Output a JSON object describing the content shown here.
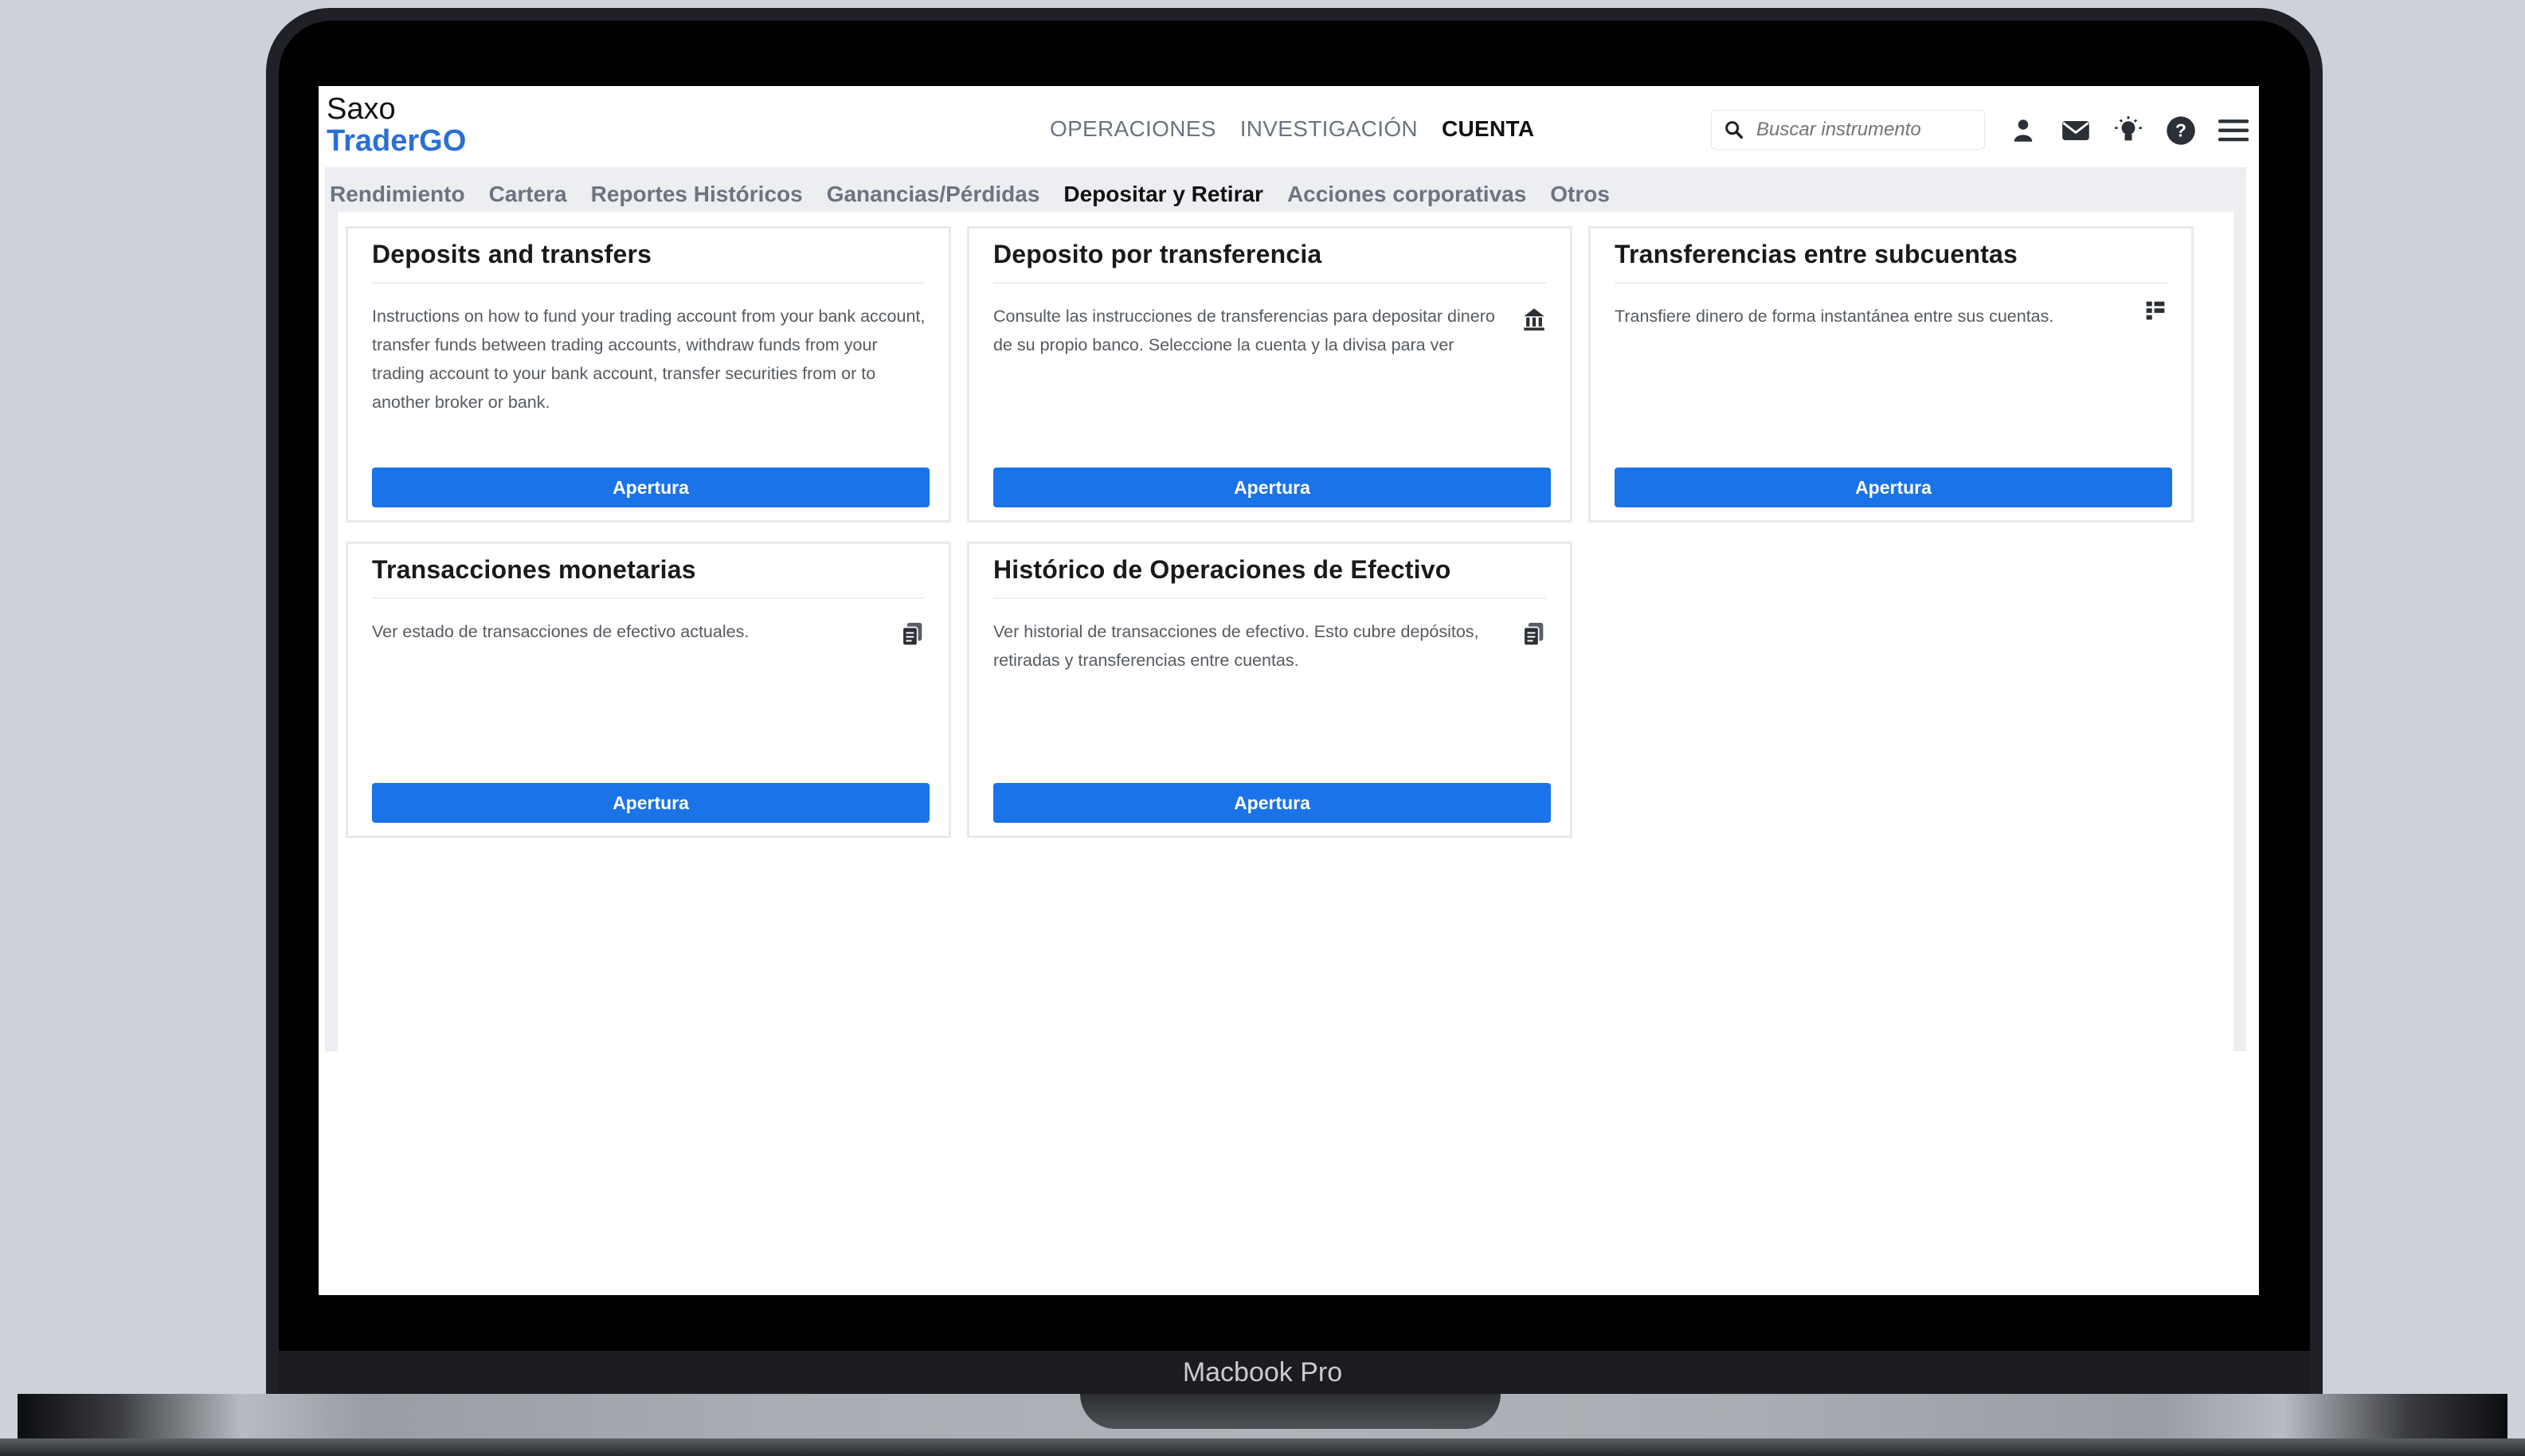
{
  "device": {
    "label": "Macbook Pro"
  },
  "logo": {
    "line1": "Saxo",
    "line2": "TraderGO"
  },
  "topnav": [
    {
      "label": "OPERACIONES",
      "active": false
    },
    {
      "label": "INVESTIGACIÓN",
      "active": false
    },
    {
      "label": "CUENTA",
      "active": true
    }
  ],
  "search": {
    "placeholder": "Buscar instrumento"
  },
  "header_icons": [
    "user-icon",
    "mail-icon",
    "lightbulb-icon",
    "help-icon",
    "menu-icon"
  ],
  "subnav": [
    {
      "label": "Rendimiento",
      "active": false
    },
    {
      "label": "Cartera",
      "active": false
    },
    {
      "label": "Reportes Históricos",
      "active": false
    },
    {
      "label": "Ganancias/Pérdidas",
      "active": false
    },
    {
      "label": "Depositar y Retirar",
      "active": true
    },
    {
      "label": "Acciones corporativas",
      "active": false
    },
    {
      "label": "Otros",
      "active": false
    }
  ],
  "cards": [
    {
      "title": "Deposits and transfers",
      "description": "Instructions on how to fund your trading account from your bank account, transfer funds between trading accounts, withdraw funds from your trading account to your bank account, transfer securities from or to another broker or bank.",
      "button": "Apertura"
    },
    {
      "title": "Deposito por transferencia",
      "description": "Consulte las instrucciones de transferencias para depositar dinero de su propio banco. Seleccione la cuenta y la divisa para ver",
      "icon": "bank-icon",
      "button": "Apertura"
    },
    {
      "title": "Transferencias entre subcuentas",
      "description": "Transfiere dinero de forma instantánea entre sus cuentas.",
      "icon": "transfer-icon",
      "button": "Apertura"
    },
    {
      "title": "Transacciones monetarias",
      "description": "Ver estado de transacciones de efectivo actuales.",
      "icon": "documents-icon",
      "button": "Apertura"
    },
    {
      "title": "Histórico de Operaciones de Efectivo",
      "description": "Ver historial de transacciones de efectivo. Esto cubre depósitos, retiradas y transferencias entre cuentas.",
      "icon": "documents-icon",
      "button": "Apertura"
    }
  ],
  "colors": {
    "accent": "#1a73e8",
    "logo_blue": "#2a6fd6",
    "nav_inactive": "#6c7480"
  }
}
